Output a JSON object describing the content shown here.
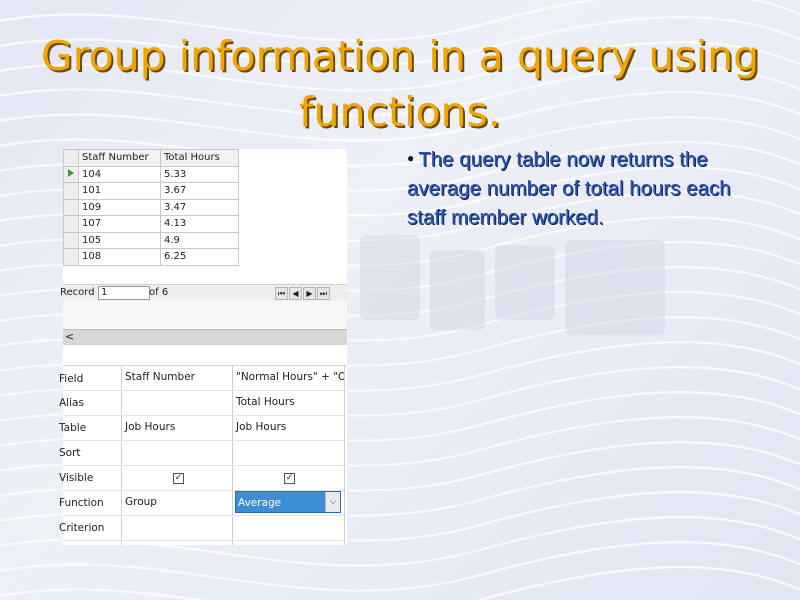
{
  "slide": {
    "title_line1": "Group information in a query using",
    "title_line2": "functions.",
    "bullet": "The query table now returns the average number of total hours each staff member worked.",
    "title_color": "#f0a500",
    "bullet_color": "#2a56b8"
  },
  "result_grid": {
    "columns": [
      "Staff Number",
      "Total Hours"
    ],
    "rows": [
      [
        "104",
        "5.33"
      ],
      [
        "101",
        "3.67"
      ],
      [
        "109",
        "3.47"
      ],
      [
        "107",
        "4.13"
      ],
      [
        "105",
        "4.9"
      ],
      [
        "108",
        "6.25"
      ]
    ],
    "record_label": "Record",
    "record_value": "1",
    "record_of": "of 6"
  },
  "design_grid": {
    "row_labels": [
      "Field",
      "Alias",
      "Table",
      "Sort",
      "Visible",
      "Function",
      "Criterion"
    ],
    "col1": {
      "field": "Staff Number",
      "alias": "",
      "table": "Job Hours",
      "sort": "",
      "visible": true,
      "function": "Group",
      "criterion": ""
    },
    "col2": {
      "field": "\"Normal Hours\" + \"Ov",
      "alias": "Total Hours",
      "table": "Job Hours",
      "sort": "",
      "visible": true,
      "function": "Average",
      "criterion": ""
    }
  },
  "icons": {
    "current_row": "row-pointer-icon",
    "nav_first": "first-record-icon",
    "nav_prev": "previous-record-icon",
    "nav_next": "next-record-icon",
    "nav_last": "last-record-icon",
    "scroll_left": "scroll-left-icon",
    "dropdown": "chevron-down-icon",
    "checkbox": "checkbox-icon"
  }
}
